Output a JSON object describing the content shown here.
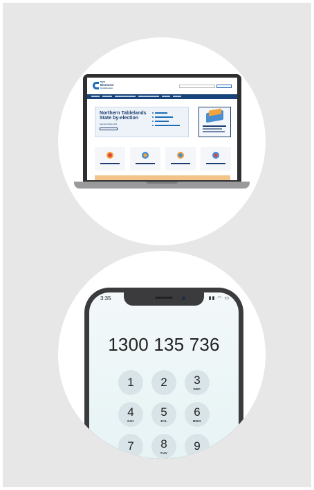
{
  "laptop": {
    "site_logo_small": "NSW",
    "site_logo_big": "Electoral",
    "site_logo_sub": "Commission",
    "hero_title": "Northern Tablelands State by-election",
    "hero_date": "Saturday 19 May 2023"
  },
  "phone": {
    "time": "3:35",
    "status_icons": "▮▮ ◠ ▭",
    "dialed_number": "1300 135 736",
    "keys": [
      {
        "digit": "1",
        "letters": ""
      },
      {
        "digit": "2",
        "letters": ""
      },
      {
        "digit": "3",
        "letters": "DEF"
      },
      {
        "digit": "4",
        "letters": "GHI"
      },
      {
        "digit": "5",
        "letters": "JKL"
      },
      {
        "digit": "6",
        "letters": "MNO"
      },
      {
        "digit": "7",
        "letters": ""
      },
      {
        "digit": "8",
        "letters": "TUV"
      },
      {
        "digit": "9",
        "letters": ""
      }
    ]
  },
  "colors": {
    "background": "#e7e7e7",
    "circle": "#ffffff",
    "brand_navy": "#16437a",
    "key_fill": "#d8e4e8"
  }
}
